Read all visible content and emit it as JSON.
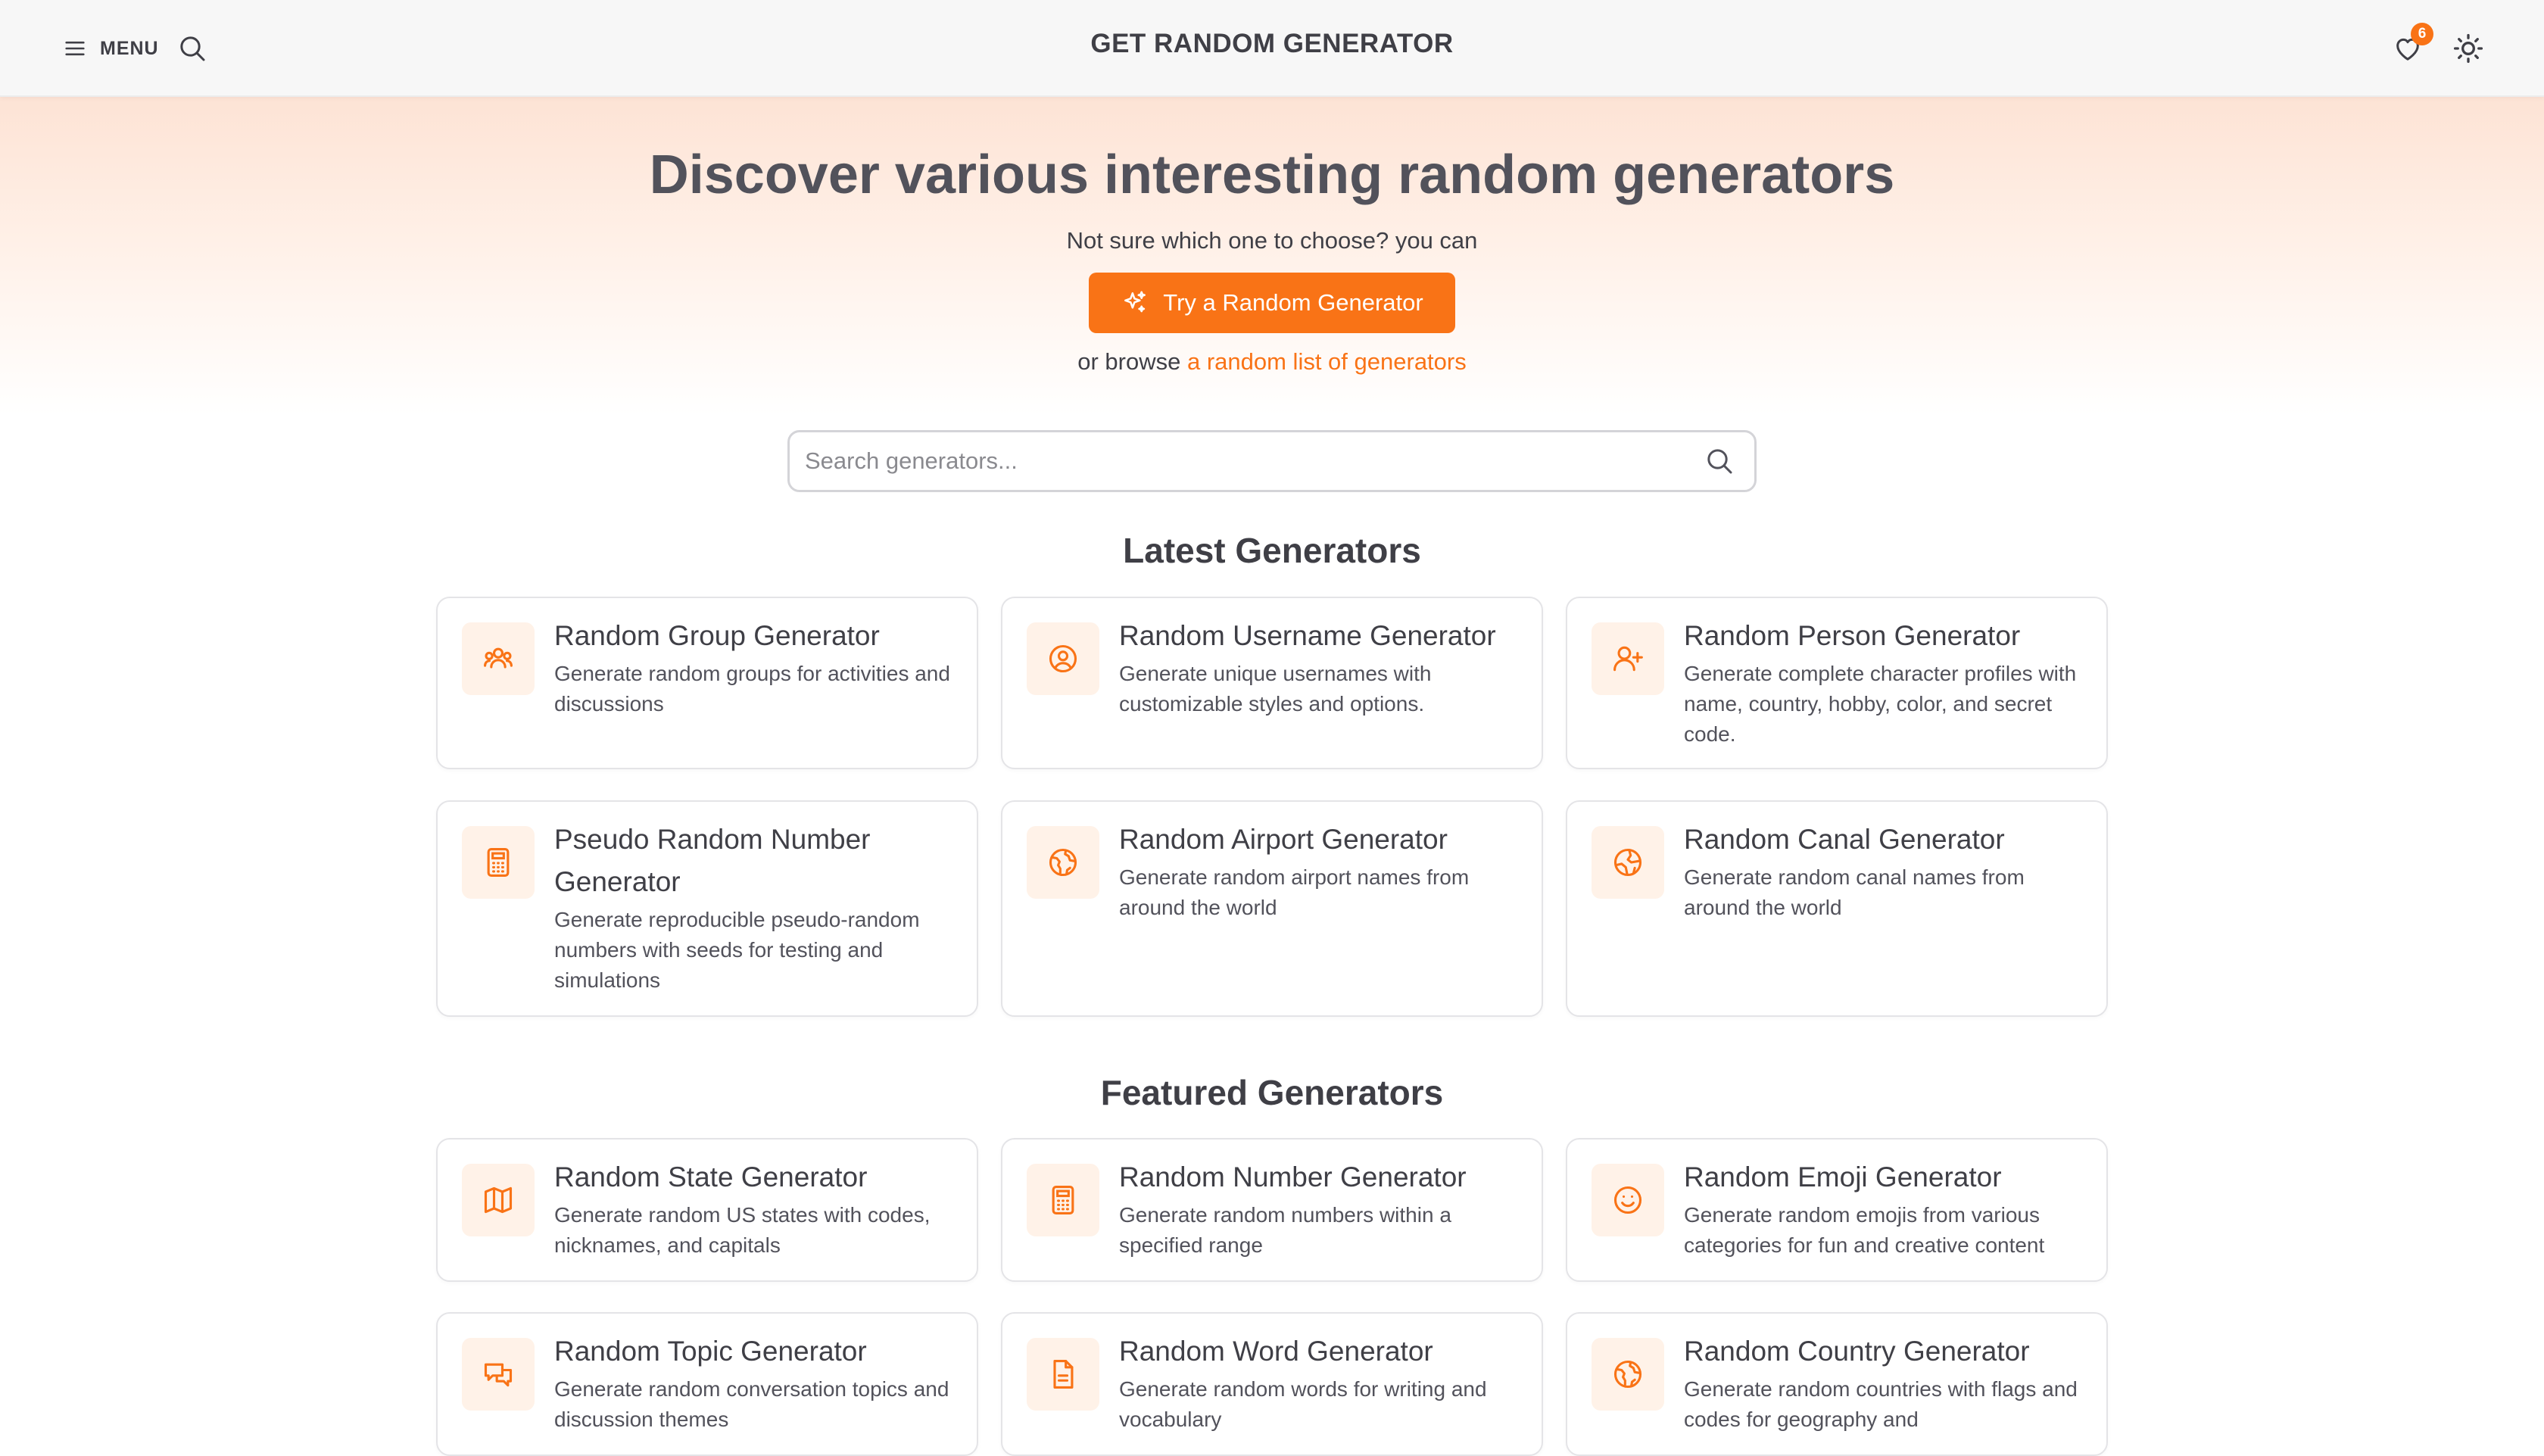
{
  "header": {
    "menu_label": "MENU",
    "site_title": "GET RANDOM GENERATOR",
    "favorites_count": "6"
  },
  "hero": {
    "title": "Discover various interesting random generators",
    "subtitle": "Not sure which one to choose? you can",
    "cta_label": "Try a Random Generator",
    "browse_prefix": "or browse",
    "browse_link": "a random list of generators"
  },
  "search": {
    "placeholder": "Search generators..."
  },
  "latest": {
    "title": "Latest Generators",
    "items": [
      {
        "title": "Random Group Generator",
        "desc": "Generate random groups for activities and discussions",
        "icon": "group-icon"
      },
      {
        "title": "Random Username Generator",
        "desc": "Generate unique usernames with customizable styles and options.",
        "icon": "user-circle-icon"
      },
      {
        "title": "Random Person Generator",
        "desc": "Generate complete character profiles with name, country, hobby, color, and secret code.",
        "icon": "user-plus-icon"
      },
      {
        "title": "Pseudo Random Number Generator",
        "desc": "Generate reproducible pseudo-random numbers with seeds for testing and simulations",
        "icon": "calculator-icon"
      },
      {
        "title": "Random Airport Generator",
        "desc": "Generate random airport names from around the world",
        "icon": "globe-icon"
      },
      {
        "title": "Random Canal Generator",
        "desc": "Generate random canal names from around the world",
        "icon": "globe-meridians-icon"
      }
    ]
  },
  "featured": {
    "title": "Featured Generators",
    "items": [
      {
        "title": "Random State Generator",
        "desc": "Generate random US states with codes, nicknames, and capitals",
        "icon": "map-icon"
      },
      {
        "title": "Random Number Generator",
        "desc": "Generate random numbers within a specified range",
        "icon": "calculator-icon"
      },
      {
        "title": "Random Emoji Generator",
        "desc": "Generate random emojis from various categories for fun and creative content",
        "icon": "smile-icon"
      },
      {
        "title": "Random Topic Generator",
        "desc": "Generate random conversation topics and discussion themes",
        "icon": "chat-bubbles-icon"
      },
      {
        "title": "Random Word Generator",
        "desc": "Generate random words for writing and vocabulary",
        "icon": "document-icon"
      },
      {
        "title": "Random Country Generator",
        "desc": "Generate random countries with flags and codes for geography and",
        "icon": "globe-icon"
      }
    ]
  },
  "colors": {
    "accent": "#f97316",
    "icon_bg": "#fff2e8",
    "hero_gradient_top": "#fde3d5"
  }
}
